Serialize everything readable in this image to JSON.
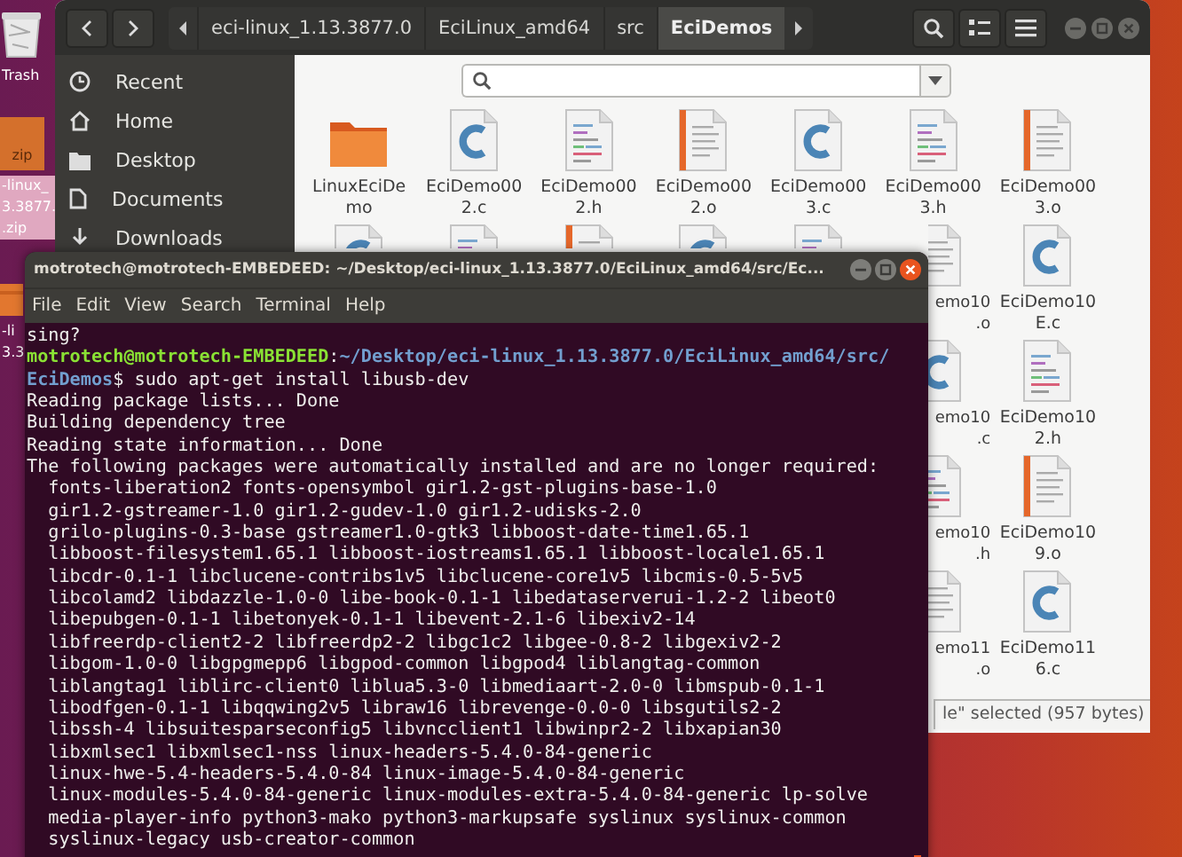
{
  "desktop_icons": [
    {
      "kind": "trash",
      "label_lines": [
        "Trash"
      ],
      "selected": false
    },
    {
      "kind": "zip",
      "badge": "zip",
      "label_lines": [
        "-linux_",
        "3.3877.",
        ".zip"
      ],
      "selected": true
    },
    {
      "kind": "archive",
      "label_lines": [
        "-li",
        "3.3"
      ],
      "selected": false
    }
  ],
  "file_manager": {
    "path_bar": [
      {
        "label": "eci-linux_1.13.3877.0",
        "selected": false
      },
      {
        "label": "EciLinux_amd64",
        "selected": false
      },
      {
        "label": "src",
        "selected": false
      },
      {
        "label": "EciDemos",
        "selected": true
      }
    ],
    "sidebar": [
      {
        "kind": "recent",
        "label": "Recent"
      },
      {
        "kind": "home",
        "label": "Home"
      },
      {
        "kind": "desktop",
        "label": "Desktop"
      },
      {
        "kind": "documents",
        "label": "Documents"
      },
      {
        "kind": "downloads",
        "label": "Downloads"
      }
    ],
    "files": [
      [
        {
          "kind": "folder",
          "label_lines": [
            "LinuxEciDe",
            "mo"
          ]
        },
        {
          "kind": "c",
          "label_lines": [
            "EciDemo00",
            "2.c"
          ]
        },
        {
          "kind": "h",
          "label_lines": [
            "EciDemo00",
            "2.h"
          ]
        },
        {
          "kind": "o",
          "label_lines": [
            "EciDemo00",
            "2.o"
          ]
        },
        {
          "kind": "c",
          "label_lines": [
            "EciDemo00",
            "3.c"
          ]
        },
        {
          "kind": "h",
          "label_lines": [
            "EciDemo00",
            "3.h"
          ]
        },
        {
          "kind": "o",
          "label_lines": [
            "EciDemo00",
            "3.o"
          ]
        }
      ],
      [
        {
          "kind": "c"
        },
        {
          "kind": "h"
        },
        {
          "kind": "o"
        },
        {
          "kind": "c"
        },
        {
          "kind": "h"
        },
        {
          "kind": "o",
          "label_lines": [
            "emo10",
            ".o"
          ],
          "cut": true
        },
        {
          "kind": "c",
          "label_lines": [
            "EciDemo10",
            "E.c"
          ]
        }
      ],
      [
        {
          "kind": "c",
          "label_lines": [
            "emo10",
            ".c"
          ],
          "cut": true
        },
        {
          "kind": "h",
          "label_lines": [
            "EciDemo10",
            "2.h"
          ]
        }
      ],
      [
        {
          "kind": "h",
          "label_lines": [
            "emo10",
            ".h"
          ],
          "cut": true
        },
        {
          "kind": "o",
          "label_lines": [
            "EciDemo10",
            "9.o"
          ]
        }
      ],
      [
        {
          "kind": "o",
          "label_lines": [
            "emo11",
            ".o"
          ],
          "cut": true
        },
        {
          "kind": "c",
          "label_lines": [
            "EciDemo11",
            "6.c"
          ]
        }
      ]
    ],
    "status": "le\" selected (957 bytes)"
  },
  "terminal": {
    "title": "motrotech@motrotech-EMBEDEED: ~/Desktop/eci-linux_1.13.3877.0/EciLinux_amd64/src/Ec...",
    "menu": [
      "File",
      "Edit",
      "View",
      "Search",
      "Terminal",
      "Help"
    ],
    "lines": [
      [
        {
          "kind": "plain",
          "text": "sing?"
        }
      ],
      [
        {
          "kind": "user",
          "text": "motrotech@motrotech-EMBEDEED"
        },
        {
          "kind": "plain",
          "text": ":"
        },
        {
          "kind": "path",
          "text": "~/Desktop/eci-linux_1.13.3877.0/EciLinux_amd64/src/"
        }
      ],
      [
        {
          "kind": "path",
          "text": "EciDemos"
        },
        {
          "kind": "plain",
          "text": "$ sudo apt-get install libusb-dev"
        }
      ],
      [
        {
          "kind": "plain",
          "text": "Reading package lists... Done"
        }
      ],
      [
        {
          "kind": "plain",
          "text": "Building dependency tree"
        }
      ],
      [
        {
          "kind": "plain",
          "text": "Reading state information... Done"
        }
      ],
      [
        {
          "kind": "plain",
          "text": "The following packages were automatically installed and are no longer required:"
        }
      ],
      [
        {
          "kind": "plain",
          "text": "  fonts-liberation2 fonts-opensymbol gir1.2-gst-plugins-base-1.0"
        }
      ],
      [
        {
          "kind": "plain",
          "text": "  gir1.2-gstreamer-1.0 gir1.2-gudev-1.0 gir1.2-udisks-2.0"
        }
      ],
      [
        {
          "kind": "plain",
          "text": "  grilo-plugins-0.3-base gstreamer1.0-gtk3 libboost-date-time1.65.1"
        }
      ],
      [
        {
          "kind": "plain",
          "text": "  libboost-filesystem1.65.1 libboost-iostreams1.65.1 libboost-locale1.65.1"
        }
      ],
      [
        {
          "kind": "plain",
          "text": "  libcdr-0.1-1 libclucene-contribs1v5 libclucene-core1v5 libcmis-0.5-5v5"
        }
      ],
      [
        {
          "kind": "plain",
          "text": "  libcolamd2 libdazzle-1.0-0 libe-book-0.1-1 libedataserverui-1.2-2 libeot0"
        }
      ],
      [
        {
          "kind": "plain",
          "text": "  libepubgen-0.1-1 libetonyek-0.1-1 libevent-2.1-6 libexiv2-14"
        }
      ],
      [
        {
          "kind": "plain",
          "text": "  libfreerdp-client2-2 libfreerdp2-2 libgc1c2 libgee-0.8-2 libgexiv2-2"
        }
      ],
      [
        {
          "kind": "plain",
          "text": "  libgom-1.0-0 libgpgmepp6 libgpod-common libgpod4 liblangtag-common"
        }
      ],
      [
        {
          "kind": "plain",
          "text": "  liblangtag1 liblirc-client0 liblua5.3-0 libmediaart-2.0-0 libmspub-0.1-1"
        }
      ],
      [
        {
          "kind": "plain",
          "text": "  libodfgen-0.1-1 libqqwing2v5 libraw16 librevenge-0.0-0 libsgutils2-2"
        }
      ],
      [
        {
          "kind": "plain",
          "text": "  libssh-4 libsuitesparseconfig5 libvncclient1 libwinpr2-2 libxapian30"
        }
      ],
      [
        {
          "kind": "plain",
          "text": "  libxmlsec1 libxmlsec1-nss linux-headers-5.4.0-84-generic"
        }
      ],
      [
        {
          "kind": "plain",
          "text": "  linux-hwe-5.4-headers-5.4.0-84 linux-image-5.4.0-84-generic"
        }
      ],
      [
        {
          "kind": "plain",
          "text": "  linux-modules-5.4.0-84-generic linux-modules-extra-5.4.0-84-generic lp-solve"
        }
      ],
      [
        {
          "kind": "plain",
          "text": "  media-player-info python3-mako python3-markupsafe syslinux syslinux-common"
        }
      ],
      [
        {
          "kind": "plain",
          "text": "  syslinux-legacy usb-creator-common"
        }
      ]
    ]
  }
}
